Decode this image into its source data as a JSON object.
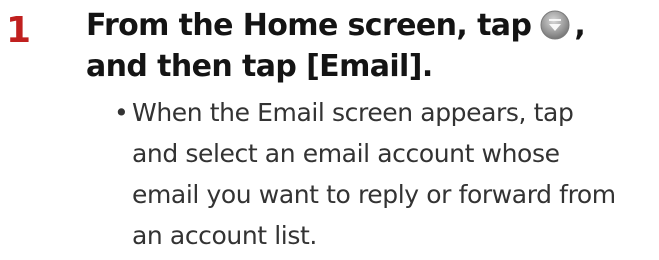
{
  "step": {
    "number": "1",
    "heading_line1_before_icon": "From the Home screen, tap",
    "heading_line1_after_icon": ",",
    "heading_line2": "and then tap [Email].",
    "icon": "home-menu-icon",
    "icon_color": "#9a9a9a"
  },
  "bullet": {
    "symbol": "•",
    "lines": [
      "When the Email screen appears, tap",
      "and select an email account whose",
      "email you want to reply or forward from",
      "an account list."
    ]
  },
  "colors": {
    "step_number": "#c0201f",
    "heading": "#141414",
    "body_text": "#333333"
  }
}
